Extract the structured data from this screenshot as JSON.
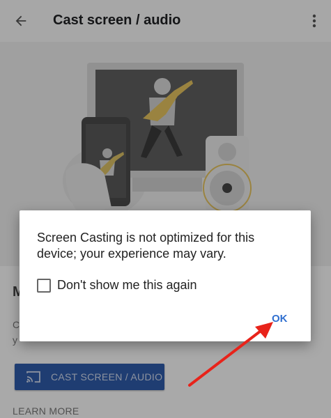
{
  "app_bar": {
    "title": "Cast screen / audio",
    "back_icon": "arrow-left-icon",
    "menu_icon": "more-vert-icon"
  },
  "hero": {
    "illustration": "musician-on-devices-illustration"
  },
  "content": {
    "heading_partial": "M",
    "description_partial_1": "C",
    "description_partial_2": "y",
    "cast_button_label": "CAST SCREEN / AUDIO",
    "cast_icon": "cast-icon",
    "learn_more_label": "LEARN MORE"
  },
  "dialog": {
    "message": "Screen Casting is not optimized for this device; your experience may vary.",
    "checkbox_label": "Don't show me this again",
    "checkbox_checked": false,
    "ok_label": "OK"
  },
  "annotation": {
    "arrow_color": "#e8231a"
  },
  "colors": {
    "accent": "#2f6fd0",
    "button_bg": "#2f5aa8",
    "illustration_gold": "#f2c04a"
  }
}
